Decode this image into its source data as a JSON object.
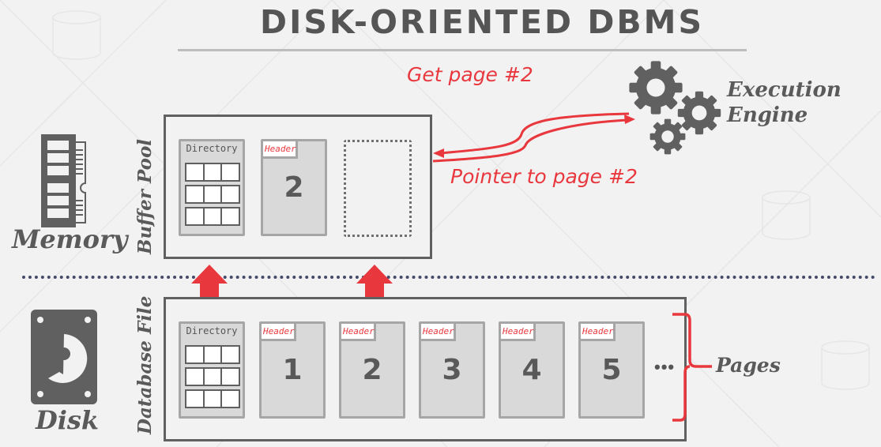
{
  "slide": {
    "title": "DISK-ORIENTED DBMS",
    "colors": {
      "accent_red": "#e8383e",
      "icon_gray": "#606060",
      "page_fill": "#d9d9d9",
      "divider": "#464a6a"
    }
  },
  "memory": {
    "label": "Memory",
    "icon": "memory-ram-icon",
    "buffer_pool": {
      "label": "Buffer Pool",
      "directory_label": "Directory",
      "pages": [
        {
          "header": "Header",
          "number": "2"
        }
      ],
      "empty_slots": 1
    }
  },
  "engine": {
    "label_line1": "Execution",
    "label_line2": "Engine",
    "icon": "gears-icon",
    "request_label": "Get page #2",
    "response_label": "Pointer to page #2"
  },
  "disk": {
    "label": "Disk",
    "icon": "hard-drive-icon",
    "database_file": {
      "label": "Database File",
      "directory_label": "Directory",
      "pages": [
        {
          "header": "Header",
          "number": "1"
        },
        {
          "header": "Header",
          "number": "2"
        },
        {
          "header": "Header",
          "number": "3"
        },
        {
          "header": "Header",
          "number": "4"
        },
        {
          "header": "Header",
          "number": "5"
        }
      ],
      "ellipsis": "•••",
      "brace_label": "Pages"
    }
  }
}
